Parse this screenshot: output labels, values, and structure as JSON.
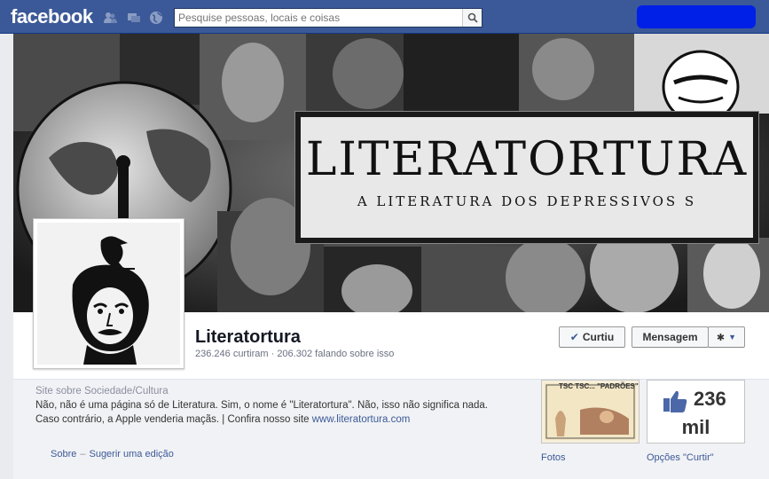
{
  "topbar": {
    "logo": "facebook",
    "search_placeholder": "Pesquise pessoas, locais e coisas"
  },
  "cover": {
    "title": "LITERATORTURA",
    "subtitle": "A LITERATURA DOS DEPRESSIVOS S"
  },
  "page": {
    "name": "Literatortura",
    "stats": "236.246 curtiram · 206.302 falando sobre isso"
  },
  "actions": {
    "liked_label": "Curtiu",
    "message_label": "Mensagem"
  },
  "about": {
    "category": "Site sobre Sociedade/Cultura",
    "text": "Não, não é uma página só de Literatura. Sim, o nome é \"Literatortura\". Não, isso não significa nada. Caso contrário, a Apple venderia maçãs. | Confira nosso site ",
    "link": "www.literatortura.com",
    "about_label": "Sobre",
    "separator": "–",
    "suggest_label": "Sugerir uma edição"
  },
  "thumbs": {
    "photos_label": "Fotos",
    "photos_caption": "TSC TSC... \"PADRÕES\"",
    "likes_number": "236",
    "likes_unit": "mil",
    "likes_label": "Opções \"Curtir\""
  },
  "colors": {
    "brand": "#3b5998",
    "redaction": "#0020e8"
  }
}
